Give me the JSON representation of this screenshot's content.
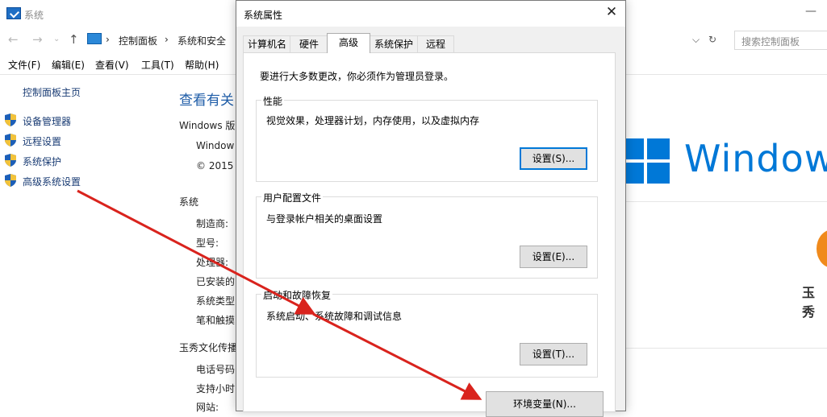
{
  "bg_window": {
    "title": "系统",
    "address": {
      "sep": "›",
      "crumbs": [
        "控制面板",
        "系统和安全"
      ],
      "search_placeholder": "搜索控制面板",
      "refresh_icon": "↻",
      "dropdown_icon": "⌵"
    },
    "menu": [
      "文件(F)",
      "编辑(E)",
      "查看(V)",
      "工具(T)",
      "帮助(H)"
    ],
    "left_nav": {
      "home": "控制面板主页",
      "items": [
        "设备管理器",
        "远程设置",
        "系统保护",
        "高级系统设置"
      ]
    },
    "main": {
      "heading": "查看有关",
      "edition_label": "Windows 版",
      "edition_value": "Window",
      "copyright": "© 2015",
      "system_label": "系统",
      "system_rows": [
        "制造商:",
        "型号:",
        "处理器:",
        "已安装的",
        "系统类型",
        "笔和触摸"
      ],
      "company_label": "玉秀文化传播",
      "company_rows": [
        "电话号码",
        "支持小时",
        "网站:"
      ]
    },
    "brand": {
      "windows_word": "Windows",
      "company_short": "玉秀",
      "windows_blue": "#0078d7",
      "brand_orange": "#f08a1c"
    }
  },
  "dialog": {
    "title": "系统属性",
    "close_icon": "✕",
    "tabs": [
      "计算机名",
      "硬件",
      "高级",
      "系统保护",
      "远程"
    ],
    "active_tab": "高级",
    "admin_note": "要进行大多数更改，你必须作为管理员登录。",
    "groups": [
      {
        "legend": "性能",
        "desc": "视觉效果，处理器计划，内存使用，以及虚拟内存",
        "button": "设置(S)..."
      },
      {
        "legend": "用户配置文件",
        "desc": "与登录帐户相关的桌面设置",
        "button": "设置(E)..."
      },
      {
        "legend": "启动和故障恢复",
        "desc": "系统启动、系统故障和调试信息",
        "button": "设置(T)..."
      }
    ],
    "env_button": "环境变量(N)..."
  },
  "annotation": {
    "arrow_color": "#d9231d"
  }
}
